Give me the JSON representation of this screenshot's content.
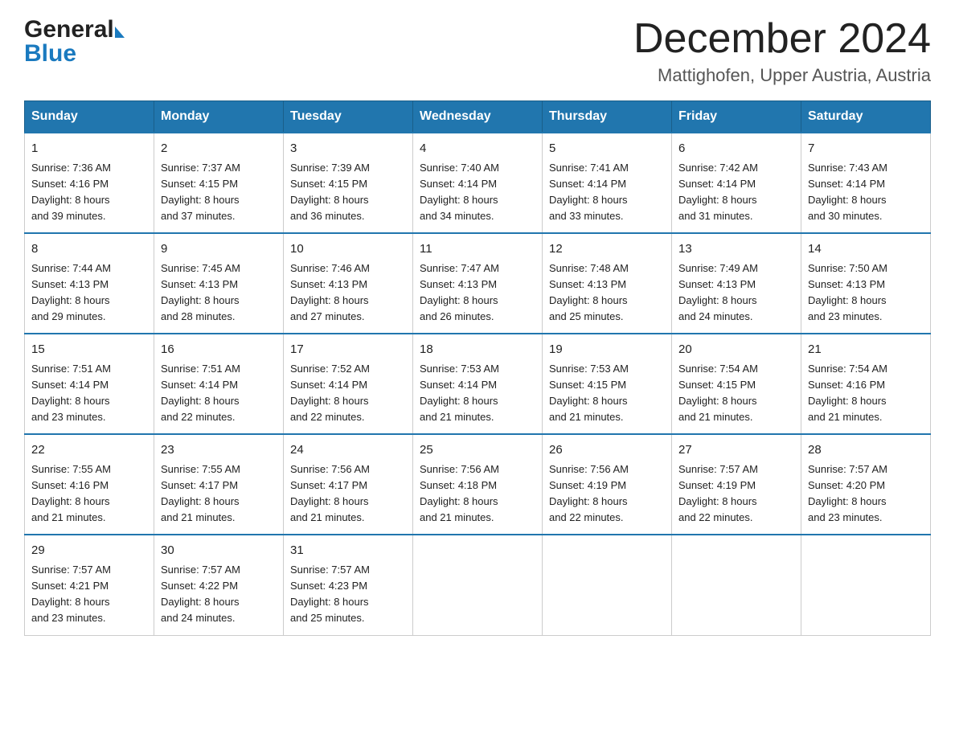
{
  "header": {
    "logo_general": "General",
    "logo_blue": "Blue",
    "month_title": "December 2024",
    "subtitle": "Mattighofen, Upper Austria, Austria"
  },
  "days_of_week": [
    "Sunday",
    "Monday",
    "Tuesday",
    "Wednesday",
    "Thursday",
    "Friday",
    "Saturday"
  ],
  "weeks": [
    [
      {
        "day": "1",
        "sunrise": "7:36 AM",
        "sunset": "4:16 PM",
        "daylight": "8 hours and 39 minutes."
      },
      {
        "day": "2",
        "sunrise": "7:37 AM",
        "sunset": "4:15 PM",
        "daylight": "8 hours and 37 minutes."
      },
      {
        "day": "3",
        "sunrise": "7:39 AM",
        "sunset": "4:15 PM",
        "daylight": "8 hours and 36 minutes."
      },
      {
        "day": "4",
        "sunrise": "7:40 AM",
        "sunset": "4:14 PM",
        "daylight": "8 hours and 34 minutes."
      },
      {
        "day": "5",
        "sunrise": "7:41 AM",
        "sunset": "4:14 PM",
        "daylight": "8 hours and 33 minutes."
      },
      {
        "day": "6",
        "sunrise": "7:42 AM",
        "sunset": "4:14 PM",
        "daylight": "8 hours and 31 minutes."
      },
      {
        "day": "7",
        "sunrise": "7:43 AM",
        "sunset": "4:14 PM",
        "daylight": "8 hours and 30 minutes."
      }
    ],
    [
      {
        "day": "8",
        "sunrise": "7:44 AM",
        "sunset": "4:13 PM",
        "daylight": "8 hours and 29 minutes."
      },
      {
        "day": "9",
        "sunrise": "7:45 AM",
        "sunset": "4:13 PM",
        "daylight": "8 hours and 28 minutes."
      },
      {
        "day": "10",
        "sunrise": "7:46 AM",
        "sunset": "4:13 PM",
        "daylight": "8 hours and 27 minutes."
      },
      {
        "day": "11",
        "sunrise": "7:47 AM",
        "sunset": "4:13 PM",
        "daylight": "8 hours and 26 minutes."
      },
      {
        "day": "12",
        "sunrise": "7:48 AM",
        "sunset": "4:13 PM",
        "daylight": "8 hours and 25 minutes."
      },
      {
        "day": "13",
        "sunrise": "7:49 AM",
        "sunset": "4:13 PM",
        "daylight": "8 hours and 24 minutes."
      },
      {
        "day": "14",
        "sunrise": "7:50 AM",
        "sunset": "4:13 PM",
        "daylight": "8 hours and 23 minutes."
      }
    ],
    [
      {
        "day": "15",
        "sunrise": "7:51 AM",
        "sunset": "4:14 PM",
        "daylight": "8 hours and 23 minutes."
      },
      {
        "day": "16",
        "sunrise": "7:51 AM",
        "sunset": "4:14 PM",
        "daylight": "8 hours and 22 minutes."
      },
      {
        "day": "17",
        "sunrise": "7:52 AM",
        "sunset": "4:14 PM",
        "daylight": "8 hours and 22 minutes."
      },
      {
        "day": "18",
        "sunrise": "7:53 AM",
        "sunset": "4:14 PM",
        "daylight": "8 hours and 21 minutes."
      },
      {
        "day": "19",
        "sunrise": "7:53 AM",
        "sunset": "4:15 PM",
        "daylight": "8 hours and 21 minutes."
      },
      {
        "day": "20",
        "sunrise": "7:54 AM",
        "sunset": "4:15 PM",
        "daylight": "8 hours and 21 minutes."
      },
      {
        "day": "21",
        "sunrise": "7:54 AM",
        "sunset": "4:16 PM",
        "daylight": "8 hours and 21 minutes."
      }
    ],
    [
      {
        "day": "22",
        "sunrise": "7:55 AM",
        "sunset": "4:16 PM",
        "daylight": "8 hours and 21 minutes."
      },
      {
        "day": "23",
        "sunrise": "7:55 AM",
        "sunset": "4:17 PM",
        "daylight": "8 hours and 21 minutes."
      },
      {
        "day": "24",
        "sunrise": "7:56 AM",
        "sunset": "4:17 PM",
        "daylight": "8 hours and 21 minutes."
      },
      {
        "day": "25",
        "sunrise": "7:56 AM",
        "sunset": "4:18 PM",
        "daylight": "8 hours and 21 minutes."
      },
      {
        "day": "26",
        "sunrise": "7:56 AM",
        "sunset": "4:19 PM",
        "daylight": "8 hours and 22 minutes."
      },
      {
        "day": "27",
        "sunrise": "7:57 AM",
        "sunset": "4:19 PM",
        "daylight": "8 hours and 22 minutes."
      },
      {
        "day": "28",
        "sunrise": "7:57 AM",
        "sunset": "4:20 PM",
        "daylight": "8 hours and 23 minutes."
      }
    ],
    [
      {
        "day": "29",
        "sunrise": "7:57 AM",
        "sunset": "4:21 PM",
        "daylight": "8 hours and 23 minutes."
      },
      {
        "day": "30",
        "sunrise": "7:57 AM",
        "sunset": "4:22 PM",
        "daylight": "8 hours and 24 minutes."
      },
      {
        "day": "31",
        "sunrise": "7:57 AM",
        "sunset": "4:23 PM",
        "daylight": "8 hours and 25 minutes."
      },
      null,
      null,
      null,
      null
    ]
  ],
  "labels": {
    "sunrise": "Sunrise:",
    "sunset": "Sunset:",
    "daylight": "Daylight:"
  }
}
